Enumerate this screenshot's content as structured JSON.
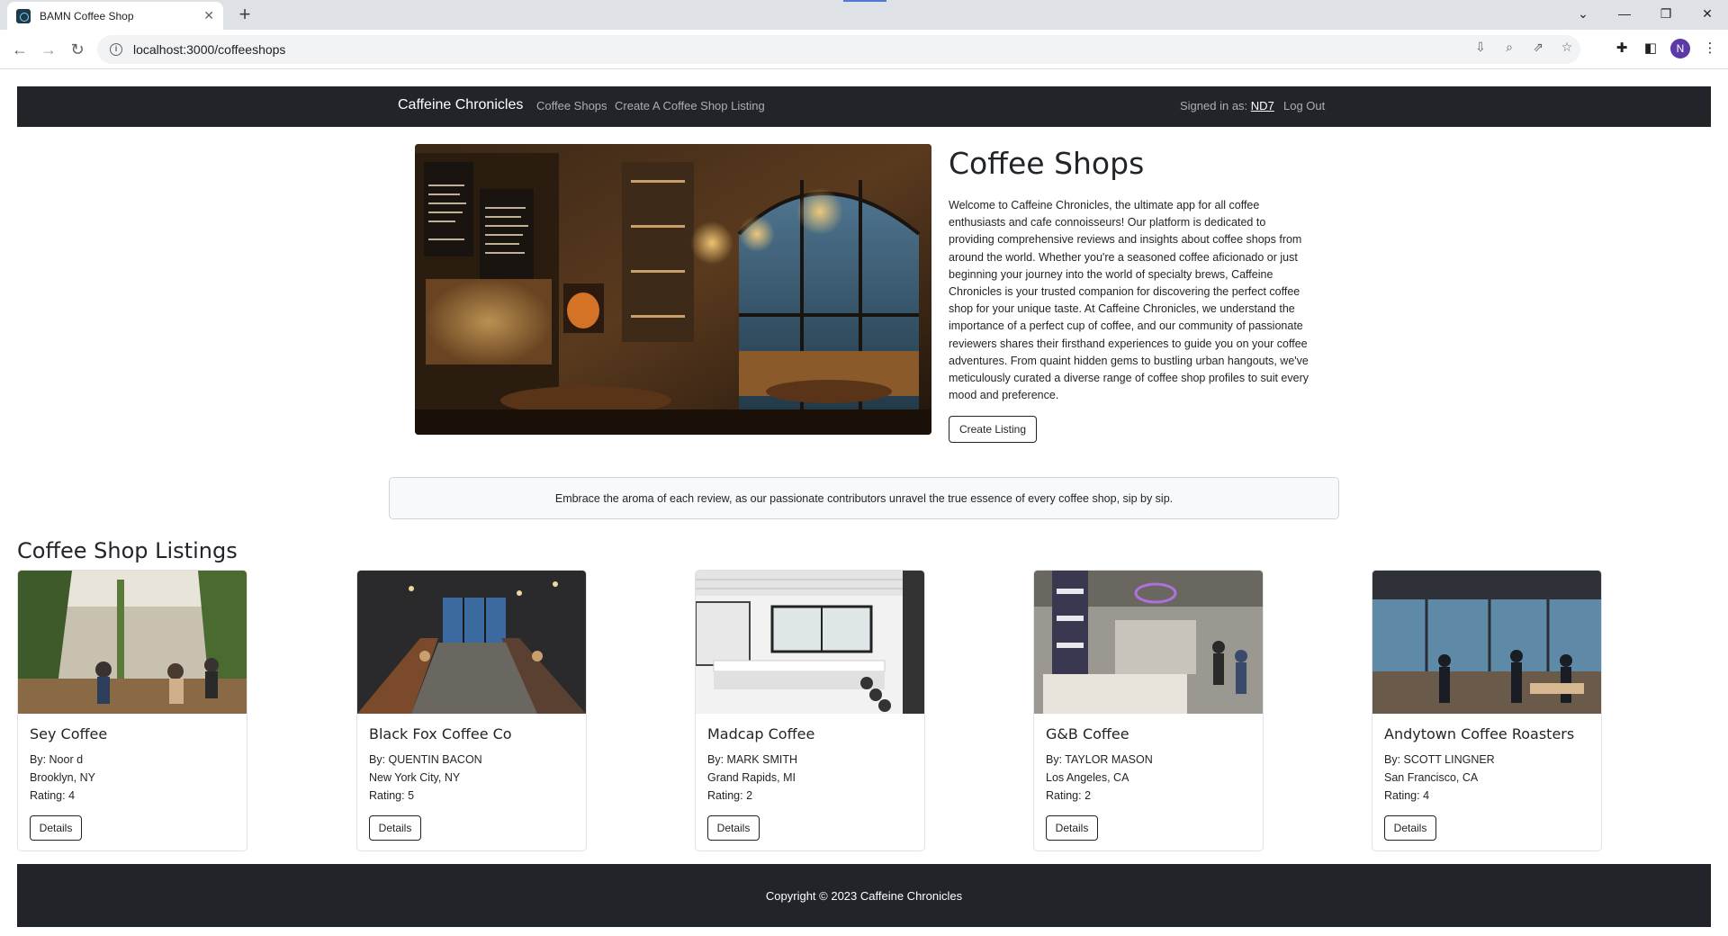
{
  "browser": {
    "tab_title": "BAMN Coffee Shop",
    "tab_close": "✕",
    "new_tab": "+",
    "url": "localhost:3000/coffeeshops",
    "window_controls": [
      "⌄",
      "—",
      "❐",
      "✕"
    ],
    "nav": {
      "back": "←",
      "forward": "→",
      "reload": "↻"
    },
    "profile_initial": "N"
  },
  "navbar": {
    "brand": "Caffeine Chronicles",
    "links": [
      "Coffee Shops",
      "Create A Coffee Shop Listing"
    ],
    "signed_in_label": "Signed in as:",
    "username": "ND7",
    "logout": "Log Out"
  },
  "hero": {
    "title": "Coffee Shops",
    "text": "Welcome to Caffeine Chronicles, the ultimate app for all coffee enthusiasts and cafe connoisseurs! Our platform is dedicated to providing comprehensive reviews and insights about coffee shops from around the world. Whether you're a seasoned coffee aficionado or just beginning your journey into the world of specialty brews, Caffeine Chronicles is your trusted companion for discovering the perfect coffee shop for your unique taste. At Caffeine Chronicles, we understand the importance of a perfect cup of coffee, and our community of passionate reviewers shares their firsthand experiences to guide you on your coffee adventures. From quaint hidden gems to bustling urban hangouts, we've meticulously curated a diverse range of coffee shop profiles to suit every mood and preference.",
    "button": "Create Listing"
  },
  "banner": "Embrace the aroma of each review, as our passionate contributors unravel the true essence of every coffee shop, sip by sip.",
  "listings": {
    "title": "Coffee Shop Listings",
    "cards": [
      {
        "name": "Sey Coffee",
        "by": "By: Noor d",
        "location": "Brooklyn, NY",
        "rating": "Rating: 4",
        "button": "Details"
      },
      {
        "name": "Black Fox Coffee Co",
        "by": "By: QUENTIN BACON",
        "location": "New York City, NY",
        "rating": "Rating: 5",
        "button": "Details"
      },
      {
        "name": "Madcap Coffee",
        "by": "By: MARK SMITH",
        "location": "Grand Rapids, MI",
        "rating": "Rating: 2",
        "button": "Details"
      },
      {
        "name": "G&B Coffee",
        "by": "By: TAYLOR MASON",
        "location": "Los Angeles, CA",
        "rating": "Rating: 2",
        "button": "Details"
      },
      {
        "name": "Andytown Coffee Roasters",
        "by": "By: SCOTT LINGNER",
        "location": "San Francisco, CA",
        "rating": "Rating: 4",
        "button": "Details"
      }
    ]
  },
  "footer": "Copyright © 2023 Caffeine Chronicles",
  "colors": {
    "navbar": "#212529",
    "banner_bg": "#f8f9fa",
    "text": "#212529"
  }
}
